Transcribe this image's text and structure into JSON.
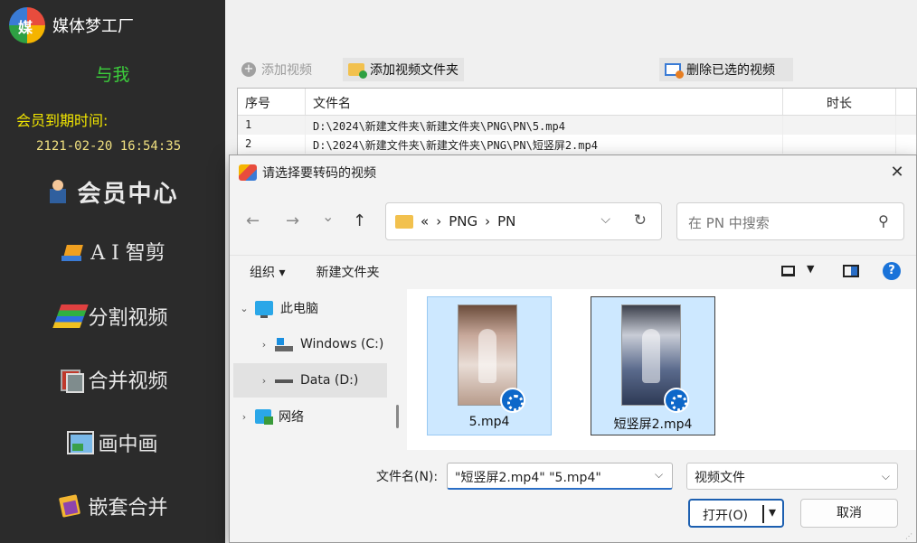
{
  "app": {
    "title": "媒体梦工厂",
    "about": "与我",
    "member_expiry_label": "会员到期时间:",
    "member_expiry_value": "2121-02-20 16:54:35"
  },
  "sidebar": {
    "items": [
      {
        "label": "会员中心",
        "icon": "vip-icon"
      },
      {
        "label": "A I 智剪",
        "icon": "ai-edit-icon"
      },
      {
        "label": "分割视频",
        "icon": "split-icon"
      },
      {
        "label": "合并视频",
        "icon": "merge-icon"
      },
      {
        "label": "画中画",
        "icon": "pip-icon"
      },
      {
        "label": "嵌套合并",
        "icon": "nest-icon"
      }
    ]
  },
  "toolbar": {
    "add_video": "添加视频",
    "add_folder": "添加视频文件夹",
    "delete_selected": "删除已选的视频"
  },
  "table": {
    "headers": [
      "序号",
      "文件名",
      "时长"
    ],
    "rows": [
      {
        "index": "1",
        "filename": "D:\\2024\\新建文件夹\\新建文件夹\\PNG\\PN\\5.mp4",
        "duration": ""
      },
      {
        "index": "2",
        "filename": "D:\\2024\\新建文件夹\\新建文件夹\\PNG\\PN\\短竖屏2.mp4",
        "duration": ""
      }
    ]
  },
  "dialog": {
    "title": "请选择要转码的视频",
    "close": "✕",
    "nav": {
      "back": "←",
      "forward": "→",
      "recent": "⌄",
      "up": "↑"
    },
    "breadcrumb": {
      "overflow": "«",
      "sep1": "›",
      "crumb1": "PNG",
      "sep2": "›",
      "crumb2": "PN"
    },
    "search_placeholder": "在 PN 中搜索",
    "organize": "组织 ▾",
    "new_folder": "新建文件夹",
    "tree": [
      {
        "arrow": "⌄",
        "label": "此电脑"
      },
      {
        "arrow": "›",
        "label": "Windows (C:)"
      },
      {
        "arrow": "›",
        "label": "Data (D:)"
      },
      {
        "arrow": "›",
        "label": "网络"
      }
    ],
    "files": [
      {
        "name": "5.mp4"
      },
      {
        "name": "短竖屏2.mp4"
      }
    ],
    "filename_label": "文件名(N):",
    "filename_value": "\"短竖屏2.mp4\" \"5.mp4\"",
    "filetype": "视频文件",
    "open_button": "打开(O)",
    "cancel_button": "取消",
    "help": "?"
  },
  "colors": {
    "sidebar_bg": "#2b2b2b",
    "about_green": "#3ccf3c",
    "member_yellow": "#f2e600",
    "selection_blue": "#cde8ff",
    "accent_blue": "#1c5fb0"
  }
}
